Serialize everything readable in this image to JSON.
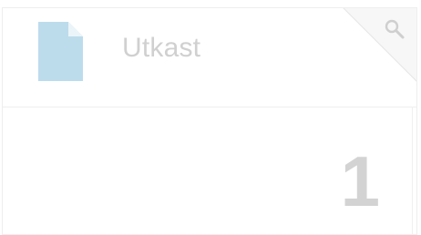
{
  "tile": {
    "title": "Utkast",
    "count": "1",
    "icon": "document-icon",
    "action_icon": "search-icon",
    "colors": {
      "icon": "#bcdcec",
      "icon_fold": "#eaf4f9",
      "text": "#d0d0d0",
      "count": "#d3d3d3"
    }
  }
}
